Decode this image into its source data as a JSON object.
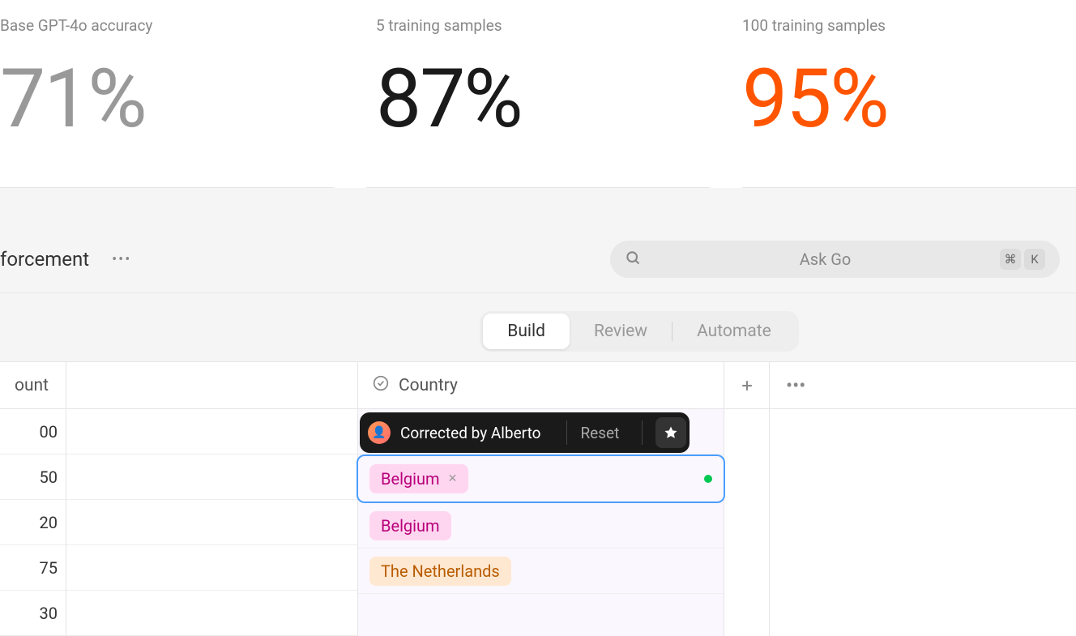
{
  "stats": [
    {
      "label": "Base GPT-4o accuracy",
      "value": "71%",
      "colorClass": "stat-gray"
    },
    {
      "label": "5 training samples",
      "value": "87%",
      "colorClass": "stat-black"
    },
    {
      "label": "100 training samples",
      "value": "95%",
      "colorClass": "stat-orange"
    }
  ],
  "app": {
    "title_partial": "forcement",
    "search": {
      "placeholder": "Ask Go",
      "shortcut_mod": "⌘",
      "shortcut_key": "K"
    },
    "tabs": {
      "build": "Build",
      "review": "Review",
      "automate": "Automate"
    },
    "columns": {
      "amount_header": "ount",
      "country_header": "Country"
    },
    "amounts": [
      "00",
      "50",
      "20",
      "75",
      "30"
    ],
    "countries": [
      {
        "label": "The Netherlands",
        "tagClass": "tag-orange"
      },
      {
        "label": "Belgium",
        "tagClass": "tag-pink",
        "editing": true
      },
      {
        "label": "Belgium",
        "tagClass": "tag-pink"
      },
      {
        "label": "The Netherlands",
        "tagClass": "tag-orange"
      }
    ],
    "tooltip": {
      "text": "Corrected by Alberto",
      "reset": "Reset"
    }
  }
}
